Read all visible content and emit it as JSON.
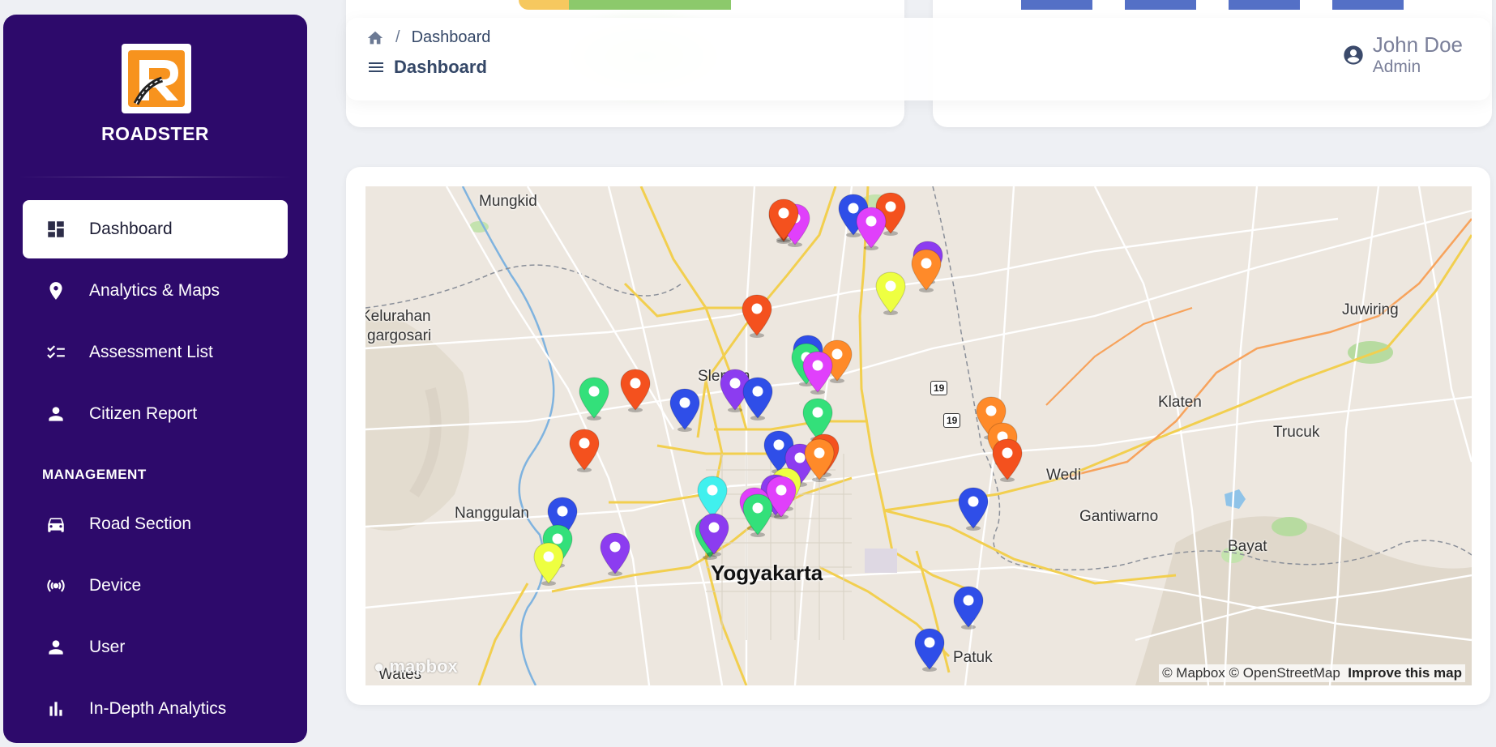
{
  "app": {
    "brand": "ROADSTER"
  },
  "sidebar": {
    "items": [
      {
        "label": "Dashboard",
        "icon": "dashboard-icon",
        "active": true
      },
      {
        "label": "Analytics & Maps",
        "icon": "location-pin-icon"
      },
      {
        "label": "Assessment List",
        "icon": "checklist-icon"
      },
      {
        "label": "Citizen Report",
        "icon": "person-icon"
      }
    ],
    "section_title": "MANAGEMENT",
    "management_items": [
      {
        "label": "Road Section",
        "icon": "car-icon"
      },
      {
        "label": "Device",
        "icon": "broadcast-icon"
      },
      {
        "label": "User",
        "icon": "person-icon"
      },
      {
        "label": "In-Depth Analytics",
        "icon": "bar-chart-icon"
      }
    ]
  },
  "header": {
    "breadcrumb": "Dashboard",
    "title": "Dashboard",
    "user_name": "John Doe",
    "user_role": "Admin"
  },
  "map": {
    "places": {
      "mungkid": "Mungkid",
      "kelurahan": "Kelurahan",
      "gargosari": "gargosari",
      "sleman": "Sleman",
      "nanggulan": "Nanggulan",
      "yogyakarta": "Yogyakarta",
      "wates": "Wates",
      "klaten": "Klaten",
      "juwiring": "Juwiring",
      "trucuk": "Trucuk",
      "wedi": "Wedi",
      "gantiwarno": "Gantiwarno",
      "bayat": "Bayat",
      "patuk": "Patuk"
    },
    "road_shields": [
      "19",
      "19",
      "19"
    ],
    "logo_text": "mapbox",
    "attribution": "© Mapbox © OpenStreetMap",
    "improve_link": "Improve this map",
    "marker_colors": {
      "red": "#f4511e",
      "magenta": "#e040fb",
      "blue": "#2f4ee8",
      "yellow": "#eeff41",
      "orange": "#ff8a29",
      "green": "#33e07a",
      "purple": "#8c3cf0",
      "cyan": "#40f0ee"
    }
  }
}
